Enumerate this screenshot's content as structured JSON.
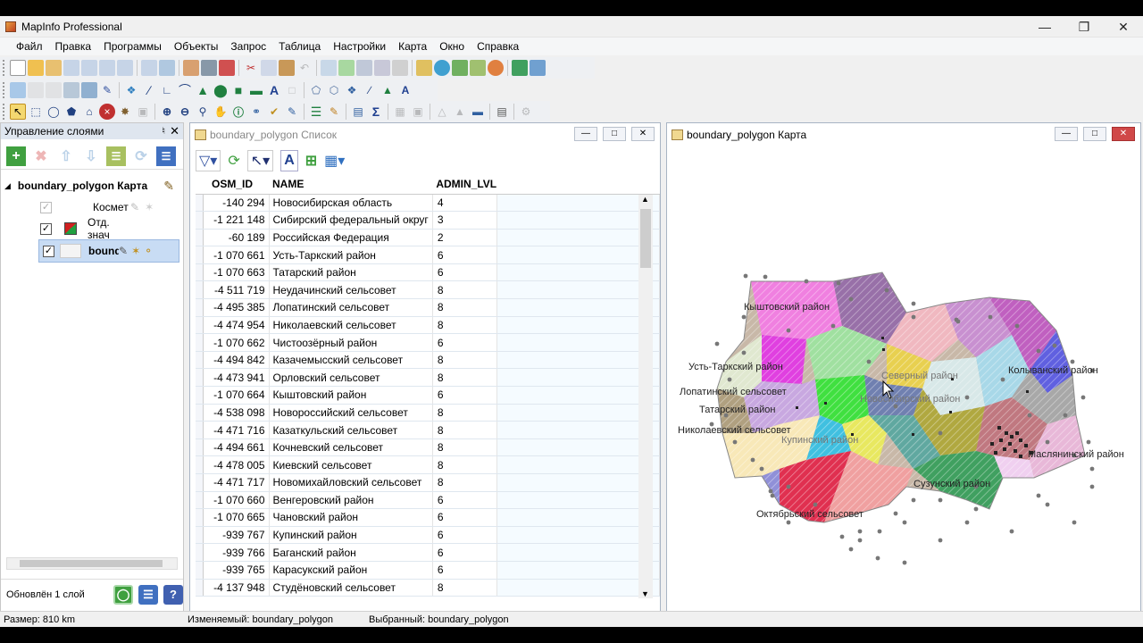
{
  "app": {
    "title": "MapInfo Professional"
  },
  "menu": [
    "Файл",
    "Правка",
    "Программы",
    "Объекты",
    "Запрос",
    "Таблица",
    "Настройки",
    "Карта",
    "Окно",
    "Справка"
  ],
  "layer_control": {
    "title": "Управление слоями",
    "root": "boundary_polygon Карта",
    "layers": [
      {
        "name": "Космет",
        "checked": true,
        "enabled": false
      },
      {
        "name": "Отд. знач",
        "checked": true,
        "enabled": true
      },
      {
        "name": "boundary_polygon",
        "checked": true,
        "enabled": true,
        "selected": true
      }
    ],
    "footer_status": "Обновлён 1 слой"
  },
  "browser": {
    "title": "boundary_polygon Список",
    "columns": [
      "OSM_ID",
      "NAME",
      "ADMIN_LVL"
    ],
    "rows": [
      [
        "-140 294",
        "Новосибирская область",
        "4"
      ],
      [
        "-1 221 148",
        "Сибирский федеральный округ",
        "3"
      ],
      [
        "-60 189",
        "Российская Федерация",
        "2"
      ],
      [
        "-1 070 661",
        "Усть-Таркский район",
        "6"
      ],
      [
        "-1 070 663",
        "Татарский район",
        "6"
      ],
      [
        "-4 511 719",
        "Неудачинский сельсовет",
        "8"
      ],
      [
        "-4 495 385",
        "Лопатинский сельсовет",
        "8"
      ],
      [
        "-4 474 954",
        "Николаевский сельсовет",
        "8"
      ],
      [
        "-1 070 662",
        "Чистоозёрный район",
        "6"
      ],
      [
        "-4 494 842",
        "Казачемысский сельсовет",
        "8"
      ],
      [
        "-4 473 941",
        "Орловский сельсовет",
        "8"
      ],
      [
        "-1 070 664",
        "Кыштовский район",
        "6"
      ],
      [
        "-4 538 098",
        "Новороссийский сельсовет",
        "8"
      ],
      [
        "-4 471 716",
        "Казаткульский сельсовет",
        "8"
      ],
      [
        "-4 494 661",
        "Кочневский сельсовет",
        "8"
      ],
      [
        "-4 478 005",
        "Киевский сельсовет",
        "8"
      ],
      [
        "-4 471 717",
        "Новомихайловский сельсовет",
        "8"
      ],
      [
        "-1 070 660",
        "Венгеровский район",
        "6"
      ],
      [
        "-1 070 665",
        "Чановский район",
        "6"
      ],
      [
        "-939 767",
        "Купинский район",
        "6"
      ],
      [
        "-939 766",
        "Баганский район",
        "6"
      ],
      [
        "-939 765",
        "Карасукский район",
        "6"
      ],
      [
        "-4 137 948",
        "Студёновский сельсовет",
        "8"
      ]
    ]
  },
  "map": {
    "title": "boundary_polygon Карта",
    "labels": [
      {
        "text": "Кыштовский район",
        "faint": false
      },
      {
        "text": "Усть-Таркский район",
        "faint": false
      },
      {
        "text": "Лопатинский сельсовет",
        "faint": false
      },
      {
        "text": "Татарский район",
        "faint": false
      },
      {
        "text": "Николаевский сельсовет",
        "faint": false
      },
      {
        "text": "Колыванский район",
        "faint": false
      },
      {
        "text": "Сузунский район",
        "faint": false
      },
      {
        "text": "Октябрьский сельсовет",
        "faint": false
      },
      {
        "text": "Северный район",
        "faint": true
      },
      {
        "text": "Новосибирский район",
        "faint": true
      },
      {
        "text": "Купинский район",
        "faint": true
      },
      {
        "text": "Маслянинский район",
        "faint": false
      }
    ]
  },
  "statusbar": {
    "size": "Размер: 810 km",
    "editable": "Изменяемый: boundary_polygon",
    "selectable": "Выбранный: boundary_polygon"
  }
}
